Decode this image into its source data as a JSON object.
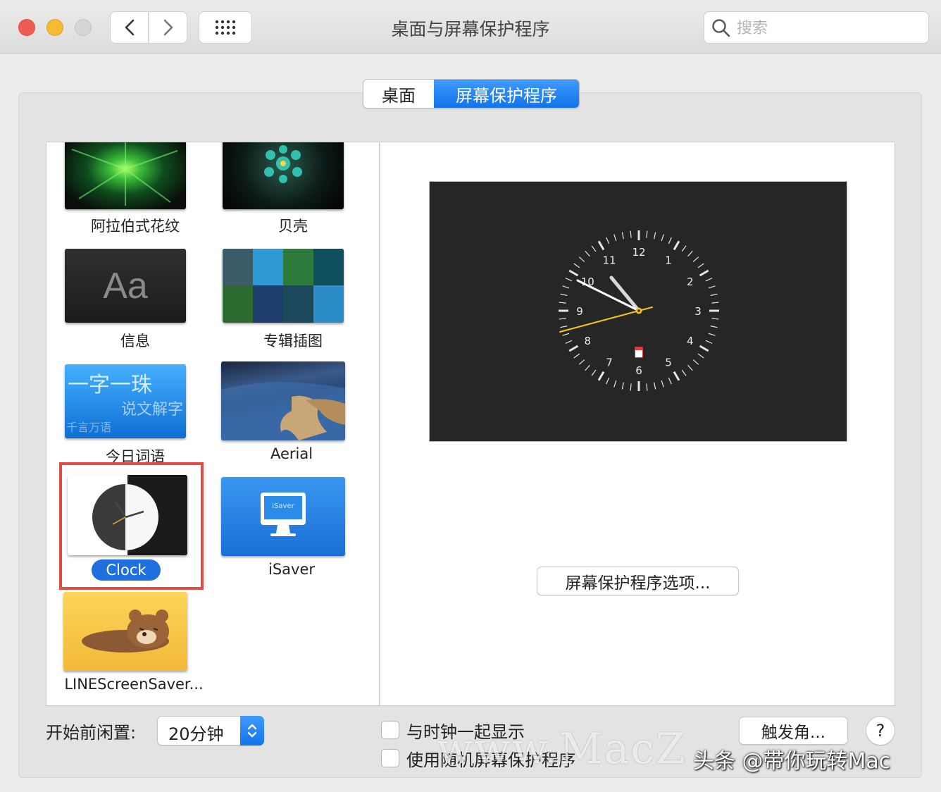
{
  "window": {
    "title": "桌面与屏幕保护程序"
  },
  "toolbar": {
    "back_icon": "chevron-left-icon",
    "forward_icon": "chevron-right-icon",
    "grid_icon": "show-all-grid-icon"
  },
  "search": {
    "placeholder": "搜索",
    "value": ""
  },
  "tabs": [
    {
      "label": "桌面",
      "selected": false
    },
    {
      "label": "屏幕保护程序",
      "selected": true
    }
  ],
  "screensavers": [
    {
      "label": "阿拉伯式花纹",
      "selected": false
    },
    {
      "label": "贝壳",
      "selected": false
    },
    {
      "label": "信息",
      "selected": false,
      "thumb_text": "Aa"
    },
    {
      "label": "专辑插图",
      "selected": false
    },
    {
      "label": "今日词语",
      "selected": false,
      "thumb_text_1": "一字一珠",
      "thumb_text_2": "说文解字",
      "thumb_text_3": "千言万语"
    },
    {
      "label": "Aerial",
      "selected": false
    },
    {
      "label": "Clock",
      "selected": true
    },
    {
      "label": "iSaver",
      "selected": false,
      "thumb_text": "iSaver"
    },
    {
      "label": "LINEScreenSaver...",
      "selected": false
    }
  ],
  "preview": {
    "clock_numbers": [
      "12",
      "1",
      "2",
      "3",
      "4",
      "5",
      "6",
      "7",
      "8",
      "9",
      "10",
      "11"
    ],
    "accent_second_hand": "#f5c518",
    "options_button_label": "屏幕保护程序选项..."
  },
  "bottom": {
    "idle_label": "开始前闲置:",
    "idle_value": "20分钟",
    "show_clock_label": "与时钟一起显示",
    "random_label": "使用随机屏幕保护程序",
    "hot_corners_label": "触发角...",
    "help_label": "?"
  },
  "watermark": {
    "site_text": "www.MacZ",
    "caption": "头条 @带你玩转Mac"
  },
  "colors": {
    "accent_blue": "#1a7cf0",
    "highlight_red": "#e34b47"
  }
}
